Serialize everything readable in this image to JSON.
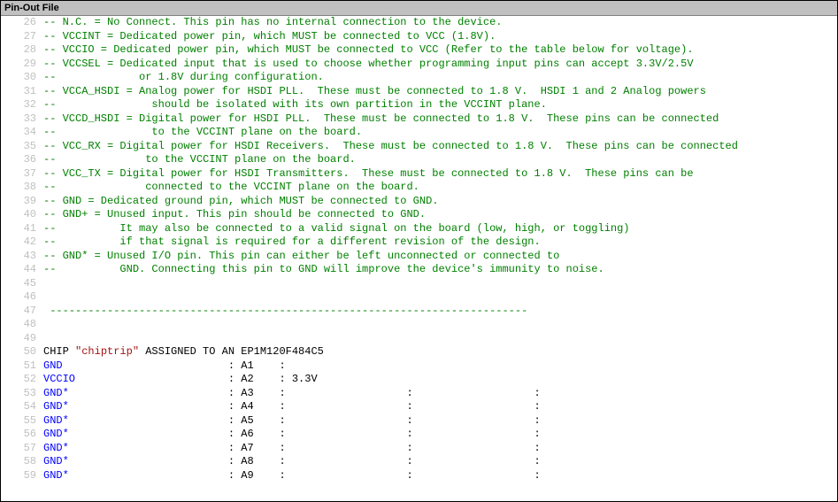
{
  "window": {
    "title": "Pin-Out File"
  },
  "lines": [
    {
      "n": 26,
      "seg": [
        {
          "cls": "comment",
          "t": "-- N.C. = No Connect. This pin has no internal connection to the device."
        }
      ]
    },
    {
      "n": 27,
      "seg": [
        {
          "cls": "comment",
          "t": "-- VCCINT = Dedicated power pin, which MUST be connected to VCC (1.8V)."
        }
      ]
    },
    {
      "n": 28,
      "seg": [
        {
          "cls": "comment",
          "t": "-- VCCIO = Dedicated power pin, which MUST be connected to VCC (Refer to the table below for voltage)."
        }
      ]
    },
    {
      "n": 29,
      "seg": [
        {
          "cls": "comment",
          "t": "-- VCCSEL = Dedicated input that is used to choose whether programming input pins can accept 3.3V/2.5V"
        }
      ]
    },
    {
      "n": 30,
      "seg": [
        {
          "cls": "comment",
          "t": "--             or 1.8V during configuration."
        }
      ]
    },
    {
      "n": 31,
      "seg": [
        {
          "cls": "comment",
          "t": "-- VCCA_HSDI = Analog power for HSDI PLL.  These must be connected to 1.8 V.  HSDI 1 and 2 Analog powers"
        }
      ]
    },
    {
      "n": 32,
      "seg": [
        {
          "cls": "comment",
          "t": "--               should be isolated with its own partition in the VCCINT plane."
        }
      ]
    },
    {
      "n": 33,
      "seg": [
        {
          "cls": "comment",
          "t": "-- VCCD_HSDI = Digital power for HSDI PLL.  These must be connected to 1.8 V.  These pins can be connected"
        }
      ]
    },
    {
      "n": 34,
      "seg": [
        {
          "cls": "comment",
          "t": "--               to the VCCINT plane on the board."
        }
      ]
    },
    {
      "n": 35,
      "seg": [
        {
          "cls": "comment",
          "t": "-- VCC_RX = Digital power for HSDI Receivers.  These must be connected to 1.8 V.  These pins can be connected"
        }
      ]
    },
    {
      "n": 36,
      "seg": [
        {
          "cls": "comment",
          "t": "--              to the VCCINT plane on the board."
        }
      ]
    },
    {
      "n": 37,
      "seg": [
        {
          "cls": "comment",
          "t": "-- VCC_TX = Digital power for HSDI Transmitters.  These must be connected to 1.8 V.  These pins can be"
        }
      ]
    },
    {
      "n": 38,
      "seg": [
        {
          "cls": "comment",
          "t": "--              connected to the VCCINT plane on the board."
        }
      ]
    },
    {
      "n": 39,
      "seg": [
        {
          "cls": "comment",
          "t": "-- GND = Dedicated ground pin, which MUST be connected to GND."
        }
      ]
    },
    {
      "n": 40,
      "seg": [
        {
          "cls": "comment",
          "t": "-- GND+ = Unused input. This pin should be connected to GND."
        }
      ]
    },
    {
      "n": 41,
      "seg": [
        {
          "cls": "comment",
          "t": "--          It may also be connected to a valid signal on the board (low, high, or toggling)"
        }
      ]
    },
    {
      "n": 42,
      "seg": [
        {
          "cls": "comment",
          "t": "--          if that signal is required for a different revision of the design."
        }
      ]
    },
    {
      "n": 43,
      "seg": [
        {
          "cls": "comment",
          "t": "-- GND* = Unused I/O pin. This pin can either be left unconnected or connected to"
        }
      ]
    },
    {
      "n": 44,
      "seg": [
        {
          "cls": "comment",
          "t": "--          GND. Connecting this pin to GND will improve the device's immunity to noise."
        }
      ]
    },
    {
      "n": 45,
      "seg": [
        {
          "cls": "plain",
          "t": ""
        }
      ]
    },
    {
      "n": 46,
      "seg": [
        {
          "cls": "plain",
          "t": ""
        }
      ]
    },
    {
      "n": 47,
      "seg": [
        {
          "cls": "comment",
          "t": " ---------------------------------------------------------------------------"
        }
      ]
    },
    {
      "n": 48,
      "seg": [
        {
          "cls": "plain",
          "t": ""
        }
      ]
    },
    {
      "n": 49,
      "seg": [
        {
          "cls": "plain",
          "t": ""
        }
      ]
    },
    {
      "n": 50,
      "seg": [
        {
          "cls": "plain",
          "t": "CHIP "
        },
        {
          "cls": "string",
          "t": "\"chiptrip\""
        },
        {
          "cls": "plain",
          "t": " ASSIGNED TO AN EP1M120F484C5"
        }
      ]
    },
    {
      "n": 51,
      "seg": [
        {
          "cls": "keyword",
          "t": "GND"
        },
        {
          "cls": "plain",
          "t": "                          : A1    :"
        }
      ]
    },
    {
      "n": 52,
      "seg": [
        {
          "cls": "keyword",
          "t": "VCCIO"
        },
        {
          "cls": "plain",
          "t": "                        : A2    : 3.3V"
        }
      ]
    },
    {
      "n": 53,
      "seg": [
        {
          "cls": "keyword",
          "t": "GND*"
        },
        {
          "cls": "plain",
          "t": "                         : A3    :                   :                   :"
        }
      ]
    },
    {
      "n": 54,
      "seg": [
        {
          "cls": "keyword",
          "t": "GND*"
        },
        {
          "cls": "plain",
          "t": "                         : A4    :                   :                   :"
        }
      ]
    },
    {
      "n": 55,
      "seg": [
        {
          "cls": "keyword",
          "t": "GND*"
        },
        {
          "cls": "plain",
          "t": "                         : A5    :                   :                   :"
        }
      ]
    },
    {
      "n": 56,
      "seg": [
        {
          "cls": "keyword",
          "t": "GND*"
        },
        {
          "cls": "plain",
          "t": "                         : A6    :                   :                   :"
        }
      ]
    },
    {
      "n": 57,
      "seg": [
        {
          "cls": "keyword",
          "t": "GND*"
        },
        {
          "cls": "plain",
          "t": "                         : A7    :                   :                   :"
        }
      ]
    },
    {
      "n": 58,
      "seg": [
        {
          "cls": "keyword",
          "t": "GND*"
        },
        {
          "cls": "plain",
          "t": "                         : A8    :                   :                   :"
        }
      ]
    },
    {
      "n": 59,
      "seg": [
        {
          "cls": "keyword",
          "t": "GND*"
        },
        {
          "cls": "plain",
          "t": "                         : A9    :                   :                   :"
        }
      ]
    }
  ]
}
